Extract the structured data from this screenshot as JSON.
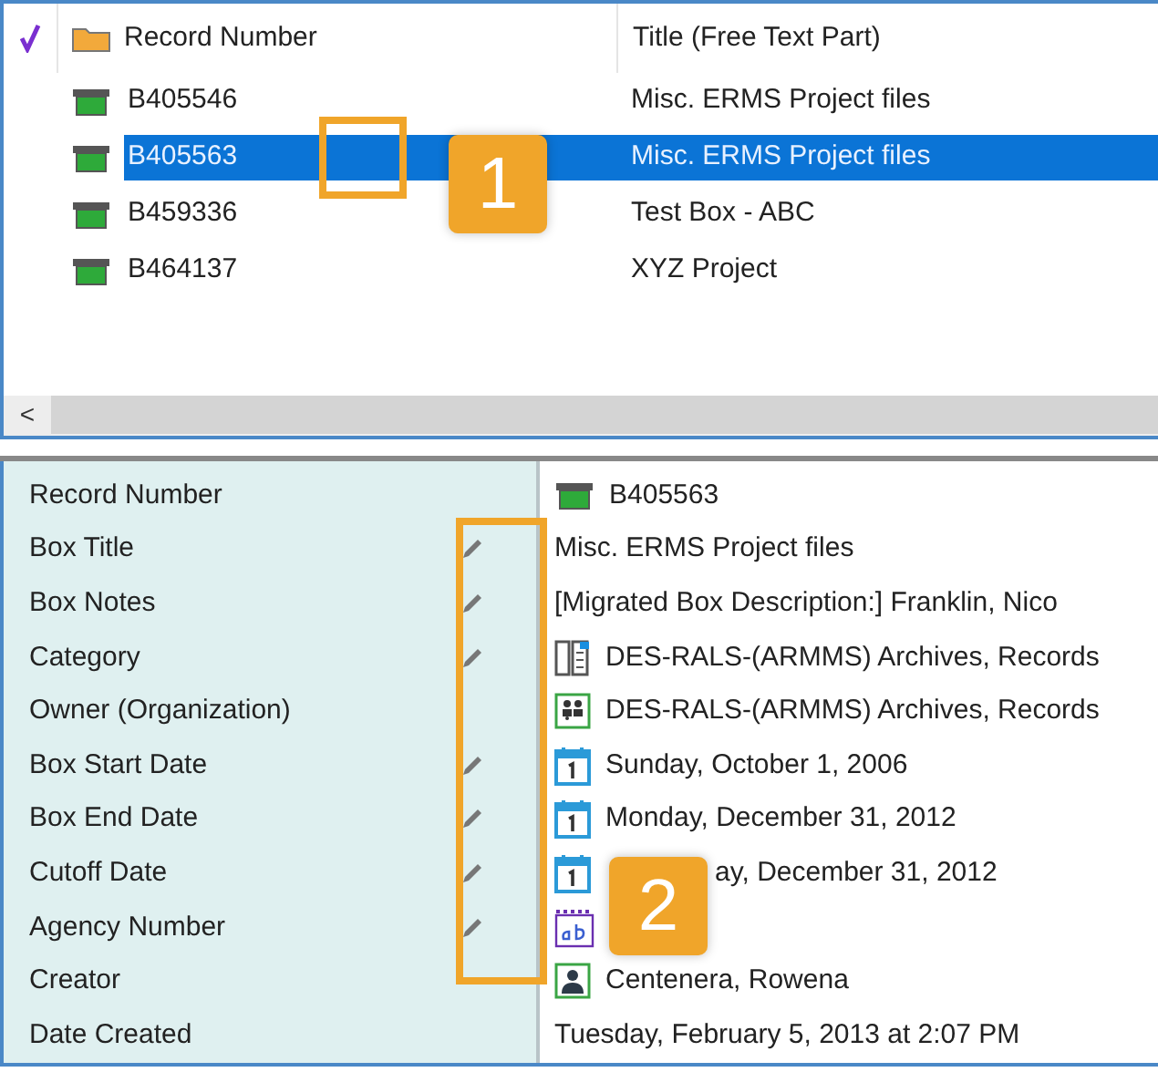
{
  "list": {
    "columns": [
      "Record Number",
      "Title (Free Text Part)"
    ],
    "rows": [
      {
        "record_number": "B405546",
        "title": "Misc. ERMS Project files",
        "selected": false
      },
      {
        "record_number": "B405563",
        "title": "Misc. ERMS Project files",
        "selected": true
      },
      {
        "record_number": "B459336",
        "title": "Test Box - ABC",
        "selected": false
      },
      {
        "record_number": "B464137",
        "title": "XYZ Project",
        "selected": false
      }
    ],
    "scroll_left": "<"
  },
  "properties": [
    {
      "label": "Record Number",
      "editable": false,
      "kind": "box",
      "value": "B405563"
    },
    {
      "label": "Box Title",
      "editable": true,
      "kind": "plain",
      "value": "Misc. ERMS Project files"
    },
    {
      "label": "Box Notes",
      "editable": true,
      "kind": "plain",
      "value": "[Migrated Box Description:] Franklin, Nico"
    },
    {
      "label": "Category",
      "editable": true,
      "kind": "category",
      "value": "DES-RALS-(ARMMS) Archives, Records"
    },
    {
      "label": "Owner (Organization)",
      "editable": false,
      "kind": "organization",
      "value": "DES-RALS-(ARMMS) Archives, Records"
    },
    {
      "label": "Box Start Date",
      "editable": true,
      "kind": "calendar",
      "value": "Sunday, October 1, 2006"
    },
    {
      "label": "Box End Date",
      "editable": true,
      "kind": "calendar",
      "value": "Monday, December 31, 2012"
    },
    {
      "label": "Cutoff Date",
      "editable": true,
      "kind": "calendar",
      "value": "ay, December 31, 2012"
    },
    {
      "label": "Agency Number",
      "editable": true,
      "kind": "text"
    },
    {
      "label": "Creator",
      "editable": false,
      "kind": "person",
      "value": "Centenera, Rowena"
    },
    {
      "label": "Date Created",
      "editable": false,
      "kind": "plain",
      "value": "Tuesday, February 5, 2013 at 2:07 PM"
    }
  ],
  "callouts": [
    "1",
    "2"
  ]
}
